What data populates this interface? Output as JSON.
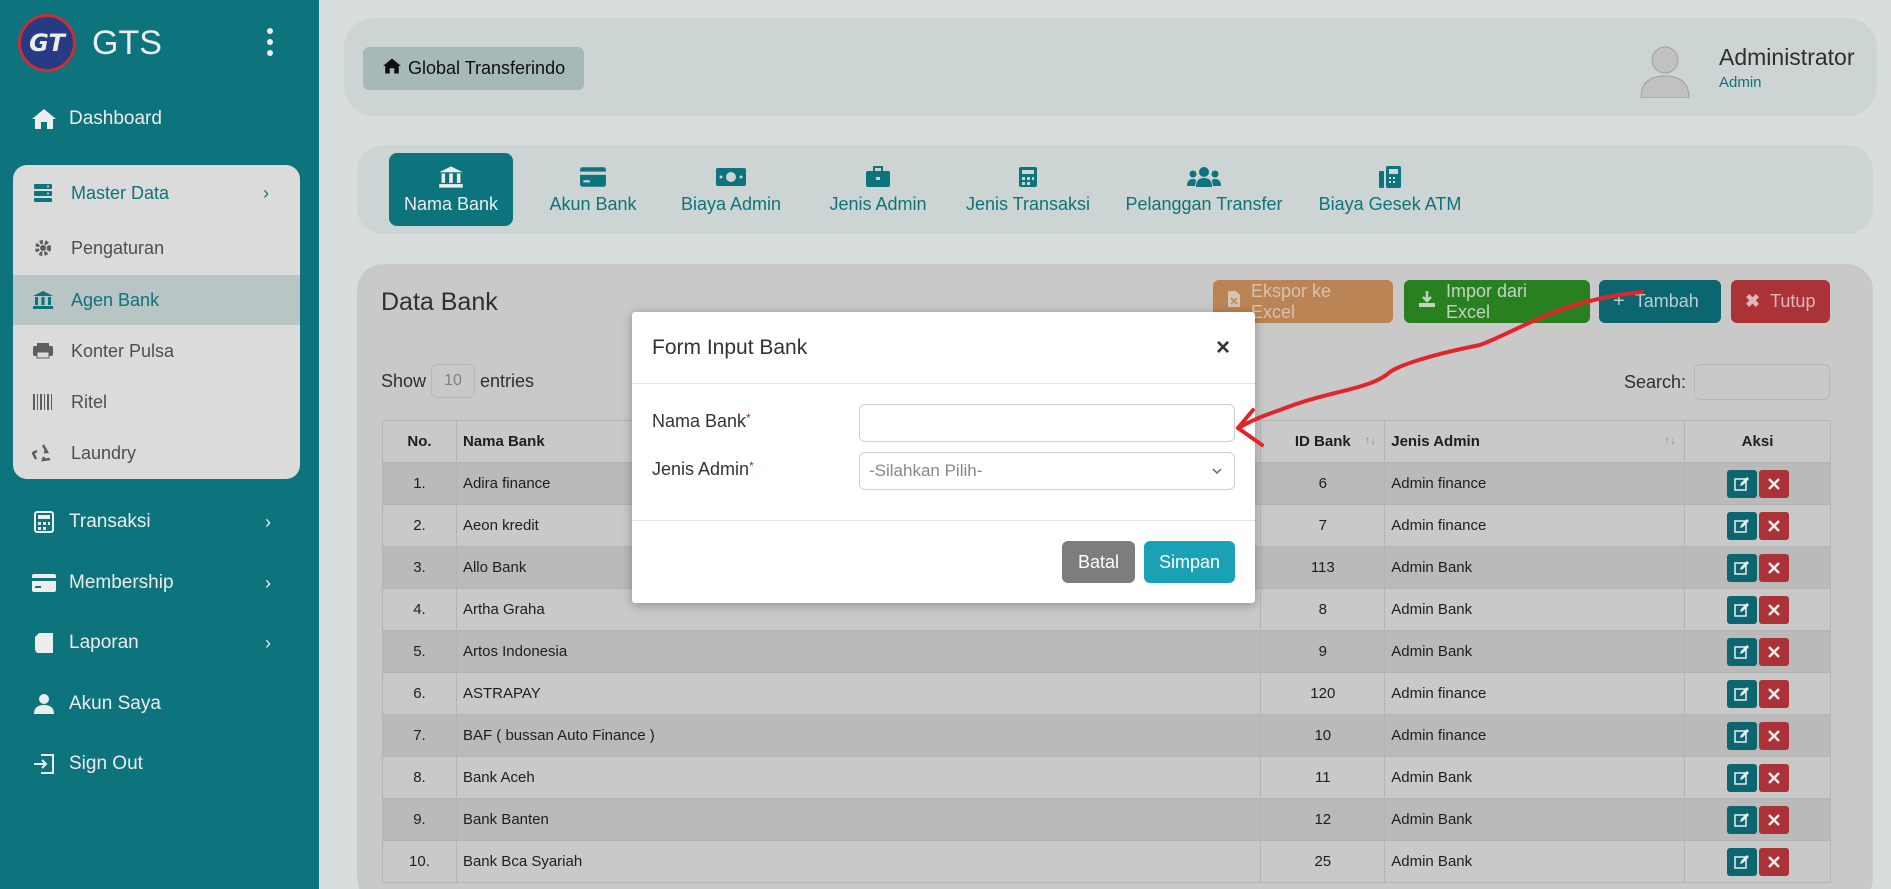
{
  "brand": {
    "logo_text": "GT",
    "name": "GTS"
  },
  "sidebar": {
    "items": [
      {
        "label": "Dashboard",
        "icon": "home-icon"
      },
      {
        "label": "Transaksi",
        "icon": "calculator-icon"
      },
      {
        "label": "Membership",
        "icon": "card-icon"
      },
      {
        "label": "Laporan",
        "icon": "book-icon"
      },
      {
        "label": "Akun Saya",
        "icon": "user-icon"
      },
      {
        "label": "Sign Out",
        "icon": "sign-out-icon"
      }
    ],
    "master": {
      "label": "Master Data",
      "items": [
        {
          "label": "Pengaturan",
          "icon": "gear-icon"
        },
        {
          "label": "Agen Bank",
          "icon": "bank-icon",
          "active": true
        },
        {
          "label": "Konter Pulsa",
          "icon": "printer-icon"
        },
        {
          "label": "Ritel",
          "icon": "barcode-icon"
        },
        {
          "label": "Laundry",
          "icon": "recycle-icon"
        }
      ]
    }
  },
  "header": {
    "home_label": "Global Transferindo",
    "user_name": "Administrator",
    "user_role": "Admin"
  },
  "tabs": [
    {
      "label": "Nama Bank",
      "icon": "bank-icon",
      "active": true
    },
    {
      "label": "Akun Bank",
      "icon": "credit-card-icon"
    },
    {
      "label": "Biaya Admin",
      "icon": "money-icon"
    },
    {
      "label": "Jenis Admin",
      "icon": "briefcase-icon"
    },
    {
      "label": "Jenis Transaksi",
      "icon": "calculator-icon"
    },
    {
      "label": "Pelanggan Transfer",
      "icon": "users-icon"
    },
    {
      "label": "Biaya Gesek ATM",
      "icon": "fax-icon"
    }
  ],
  "panel": {
    "title": "Data Bank",
    "buttons": {
      "ekspor": "Ekspor ke Excel",
      "impor": "Impor dari Excel",
      "tambah": "Tambah",
      "tutup": "Tutup"
    },
    "show_label": "Show",
    "entries_value": "10",
    "entries_label": "entries",
    "search_label": "Search:"
  },
  "table": {
    "headers": {
      "no": "No.",
      "nama": "Nama Bank",
      "id": "ID Bank",
      "jenis": "Jenis Admin",
      "aksi": "Aksi"
    },
    "rows": [
      {
        "no": "1.",
        "nama": "Adira finance",
        "id": "6",
        "jenis": "Admin finance"
      },
      {
        "no": "2.",
        "nama": "Aeon kredit",
        "id": "7",
        "jenis": "Admin finance"
      },
      {
        "no": "3.",
        "nama": "Allo Bank",
        "id": "113",
        "jenis": "Admin Bank"
      },
      {
        "no": "4.",
        "nama": "Artha Graha",
        "id": "8",
        "jenis": "Admin Bank"
      },
      {
        "no": "5.",
        "nama": "Artos Indonesia",
        "id": "9",
        "jenis": "Admin Bank"
      },
      {
        "no": "6.",
        "nama": "ASTRAPAY",
        "id": "120",
        "jenis": "Admin finance"
      },
      {
        "no": "7.",
        "nama": "BAF ( bussan Auto Finance )",
        "id": "10",
        "jenis": "Admin finance"
      },
      {
        "no": "8.",
        "nama": "Bank Aceh",
        "id": "11",
        "jenis": "Admin Bank"
      },
      {
        "no": "9.",
        "nama": "Bank Banten",
        "id": "12",
        "jenis": "Admin Bank"
      },
      {
        "no": "10.",
        "nama": "Bank Bca Syariah",
        "id": "25",
        "jenis": "Admin Bank"
      }
    ]
  },
  "modal": {
    "title": "Form Input Bank",
    "close": "×",
    "nama_label": "Nama Bank",
    "nama_value": "",
    "jenis_label": "Jenis Admin",
    "jenis_placeholder": "-Silahkan Pilih-",
    "required_mark": "*",
    "batal": "Batal",
    "simpan": "Simpan"
  },
  "colors": {
    "primary": "#0e7c86",
    "danger": "#b8363c",
    "success": "#2d8a24",
    "warning": "#c98e5c",
    "annotation": "#e0262b"
  }
}
